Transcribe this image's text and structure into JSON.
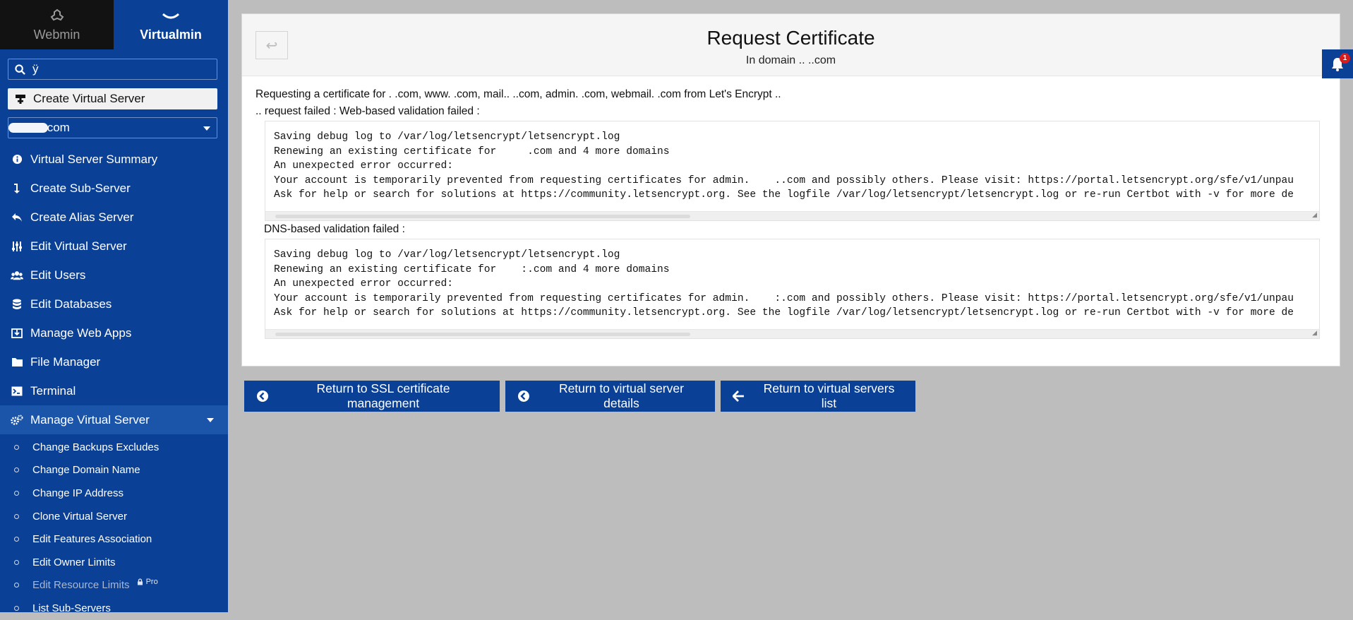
{
  "sidebar": {
    "tabs": [
      {
        "label": "Webmin",
        "icon": "webmin-logo-icon"
      },
      {
        "label": "Virtualmin",
        "icon": "virtualmin-chevron-icon"
      }
    ],
    "search_value": "ÿ",
    "create_button": "Create Virtual Server",
    "domain_selected": ".com",
    "menu": [
      {
        "label": "Virtual Server Summary",
        "icon": "info-icon"
      },
      {
        "label": "Create Sub-Server",
        "icon": "sub-server-arrow-icon"
      },
      {
        "label": "Create Alias Server",
        "icon": "reply-arrow-icon"
      },
      {
        "label": "Edit Virtual Server",
        "icon": "sliders-icon"
      },
      {
        "label": "Edit Users",
        "icon": "users-icon"
      },
      {
        "label": "Edit Databases",
        "icon": "database-icon"
      },
      {
        "label": "Manage Web Apps",
        "icon": "download-box-icon"
      },
      {
        "label": "File Manager",
        "icon": "folder-icon"
      },
      {
        "label": "Terminal",
        "icon": "terminal-icon"
      },
      {
        "label": "Manage Virtual Server",
        "icon": "gears-icon"
      }
    ],
    "submenu": [
      {
        "label": "Change Backups Excludes"
      },
      {
        "label": "Change Domain Name"
      },
      {
        "label": "Change IP Address"
      },
      {
        "label": "Clone Virtual Server"
      },
      {
        "label": "Edit Features Association"
      },
      {
        "label": "Edit Owner Limits"
      },
      {
        "label": "Edit Resource Limits",
        "badge": "Pro",
        "disabled": true
      },
      {
        "label": "List Sub-Servers"
      }
    ]
  },
  "page": {
    "title": "Request Certificate",
    "subtitle": "In domain .. ..com",
    "request_line": "Requesting a certificate for .  .com, www. .com, mail.. ..com, admin.  .com, webmail.  .com from Let's Encrypt ..",
    "failed_line": ".. request failed : Web-based validation failed :",
    "dns_line": "DNS-based validation failed :",
    "web_log": "Saving debug log to /var/log/letsencrypt/letsencrypt.log\nRenewing an existing certificate for     .com and 4 more domains\nAn unexpected error occurred:\nYour account is temporarily prevented from requesting certificates for admin.    ..com and possibly others. Please visit: https://portal.letsencrypt.org/sfe/v1/unpau\nAsk for help or search for solutions at https://community.letsencrypt.org. See the logfile /var/log/letsencrypt/letsencrypt.log or re-run Certbot with -v for more de",
    "dns_log": "Saving debug log to /var/log/letsencrypt/letsencrypt.log\nRenewing an existing certificate for    :.com and 4 more domains\nAn unexpected error occurred:\nYour account is temporarily prevented from requesting certificates for admin.    :.com and possibly others. Please visit: https://portal.letsencrypt.org/sfe/v1/unpau\nAsk for help or search for solutions at https://community.letsencrypt.org. See the logfile /var/log/letsencrypt/letsencrypt.log or re-run Certbot with -v for more de"
  },
  "actions": [
    {
      "label": "Return to SSL certificate management",
      "icon": "circle-arrow-left-icon"
    },
    {
      "label": "Return to virtual server details",
      "icon": "circle-arrow-left-icon"
    },
    {
      "label": "Return to virtual servers list",
      "icon": "arrow-left-icon"
    }
  ],
  "notifications": {
    "count": "1"
  },
  "colors": {
    "sidebar": "#0a4095",
    "active_item": "#1b55aa",
    "background": "#bdbdbd"
  }
}
